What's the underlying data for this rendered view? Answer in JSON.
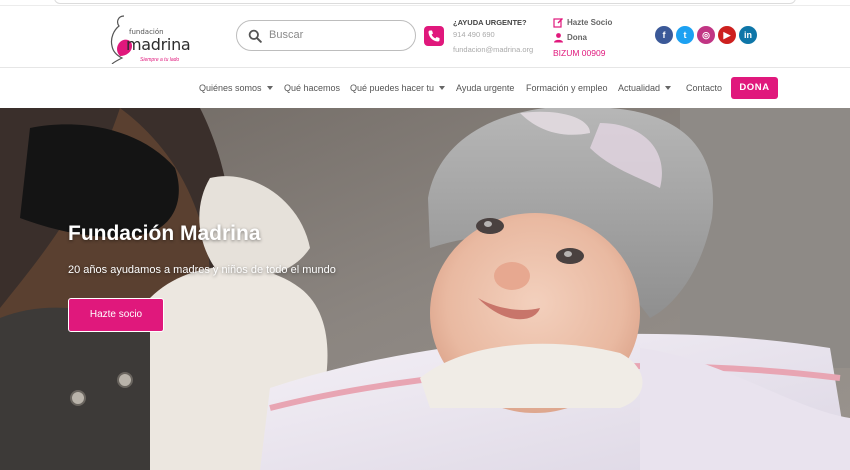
{
  "logo": {
    "small_text": "fundación",
    "name": "madrina",
    "tagline": "Siempre a tu lado"
  },
  "search": {
    "placeholder": "Buscar"
  },
  "urgent": {
    "title": "¿AYUDA URGENTE?",
    "phone": "914 490 690",
    "email": "fundacion@madrina.org"
  },
  "quick_links": {
    "hazte_socio": "Hazte Socio",
    "dona": "Dona",
    "bizum": "BIZUM 00909"
  },
  "socials": [
    {
      "name": "facebook-icon",
      "glyph": "f",
      "color": "#3b5998"
    },
    {
      "name": "twitter-icon",
      "glyph": "t",
      "color": "#1da1f2"
    },
    {
      "name": "instagram-icon",
      "glyph": "◎",
      "color": "#c13584"
    },
    {
      "name": "youtube-icon",
      "glyph": "▶",
      "color": "#cd201f"
    },
    {
      "name": "linkedin-icon",
      "glyph": "in",
      "color": "#0e76a8"
    }
  ],
  "nav": {
    "items": [
      {
        "label": "Quiénes somos",
        "dropdown": true
      },
      {
        "label": "Qué hacemos",
        "dropdown": false
      },
      {
        "label": "Qué puedes hacer tu",
        "dropdown": true
      },
      {
        "label": "Ayuda urgente",
        "dropdown": false
      },
      {
        "label": "Formación y empleo",
        "dropdown": false
      },
      {
        "label": "Actualidad",
        "dropdown": true
      },
      {
        "label": "Contacto",
        "dropdown": false
      }
    ],
    "cta": "DONA"
  },
  "hero": {
    "title": "Fundación Madrina",
    "subtitle": "20 años ayudamos a madres y niños de todo el mundo",
    "button": "Hazte socio"
  },
  "colors": {
    "accent": "#e0187c",
    "text": "#555555"
  }
}
